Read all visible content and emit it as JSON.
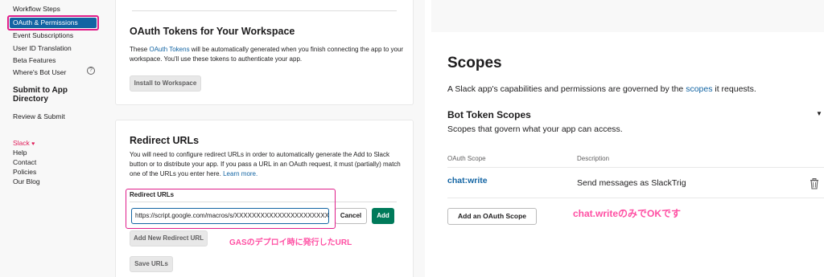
{
  "sidebar": {
    "items": [
      {
        "label": "Workflow Steps"
      },
      {
        "label": "OAuth & Permissions"
      },
      {
        "label": "Event Subscriptions"
      },
      {
        "label": "User ID Translation"
      },
      {
        "label": "Beta Features"
      },
      {
        "label": "Where's Bot User"
      }
    ],
    "help_glyph": "?",
    "section_heading": "Submit to App Directory",
    "review": "Review & Submit",
    "footer": {
      "slack": "Slack",
      "help": "Help",
      "contact": "Contact",
      "policies": "Policies",
      "blog": "Our Blog"
    }
  },
  "oauth_tokens": {
    "title": "OAuth Tokens for Your Workspace",
    "desc_pre": "These ",
    "desc_link": "OAuth Tokens",
    "desc_post": " will be automatically generated when you finish connecting the app to your workspace. You'll use these tokens to authenticate your app.",
    "install_button": "Install to Workspace"
  },
  "redirect": {
    "title": "Redirect URLs",
    "desc": "You will need to configure redirect URLs in order to automatically generate the Add to Slack button or to distribute your app. If you pass a URL in an OAuth request, it must (partially) match one of the URLs you enter here.",
    "learn_more": "Learn more.",
    "field_label": "Redirect URLs",
    "url_value": "https://script.google.com/macros/s/XXXXXXXXXXXXXXXXXXXXXXX",
    "cancel": "Cancel",
    "add": "Add",
    "add_new": "Add New Redirect URL",
    "save": "Save URLs",
    "annotation": "GASのデプロイ時に発行したURL"
  },
  "scopes": {
    "title": "Scopes",
    "desc_pre": "A Slack app's capabilities and permissions are governed by the ",
    "desc_link": "scopes",
    "desc_post": " it requests.",
    "bot_title": "Bot Token Scopes",
    "bot_desc": "Scopes that govern what your app can access.",
    "col_scope": "OAuth Scope",
    "col_desc": "Description",
    "rows": [
      {
        "scope": "chat:write",
        "description": "Send messages as SlackTrig"
      }
    ],
    "add_button": "Add an OAuth Scope",
    "annotation": "chat.writeのみでOKです"
  },
  "colors": {
    "accent": "#1264a3",
    "highlight": "#e01e8a",
    "primary_button": "#007a5a",
    "annotation_text": "#ff4fa3"
  }
}
